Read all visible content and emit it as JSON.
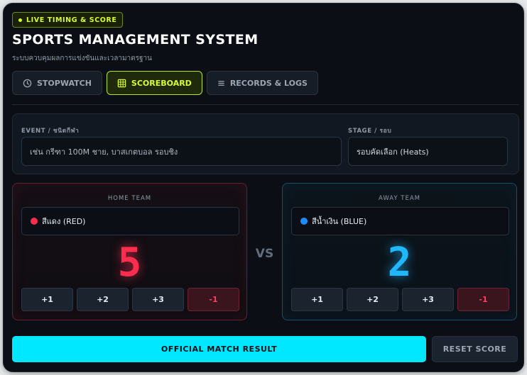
{
  "header": {
    "badge": "LIVE TIMING & SCORE",
    "title": "SPORTS MANAGEMENT SYSTEM",
    "subtitle": "ระบบควบคุมผลการแข่งขันและเวลามาตรฐาน"
  },
  "tabs": [
    {
      "label": "STOPWATCH",
      "icon": "clock-icon",
      "active": false
    },
    {
      "label": "SCOREBOARD",
      "icon": "grid-icon",
      "active": true
    },
    {
      "label": "RECORDS & LOGS",
      "icon": "list-icon",
      "active": false
    }
  ],
  "event": {
    "event_label": "EVENT / ชนิดกีฬา",
    "event_placeholder": "เช่น กรีฑา 100M ชาย, บาสเกตบอล รอบชิง",
    "stage_label": "STAGE / รอบ",
    "stage_value": "รอบคัดเลือก (Heats)"
  },
  "home": {
    "label": "HOME TEAM",
    "name": "สีแดง (RED)",
    "color": "#ff2d4d",
    "score": "5",
    "buttons": [
      "+1",
      "+2",
      "+3",
      "-1"
    ]
  },
  "away": {
    "label": "AWAY TEAM",
    "name": "สีน้ำเงิน (BLUE)",
    "color": "#1a8cff",
    "score": "2",
    "buttons": [
      "+1",
      "+2",
      "+3",
      "-1"
    ]
  },
  "vs_label": "VS",
  "actions": {
    "official": "OFFICIAL MATCH RESULT",
    "reset": "RESET SCORE"
  },
  "colors": {
    "accent_lime": "#d7ff2b",
    "accent_cyan": "#00e8ff",
    "background": "#0b0f15"
  }
}
